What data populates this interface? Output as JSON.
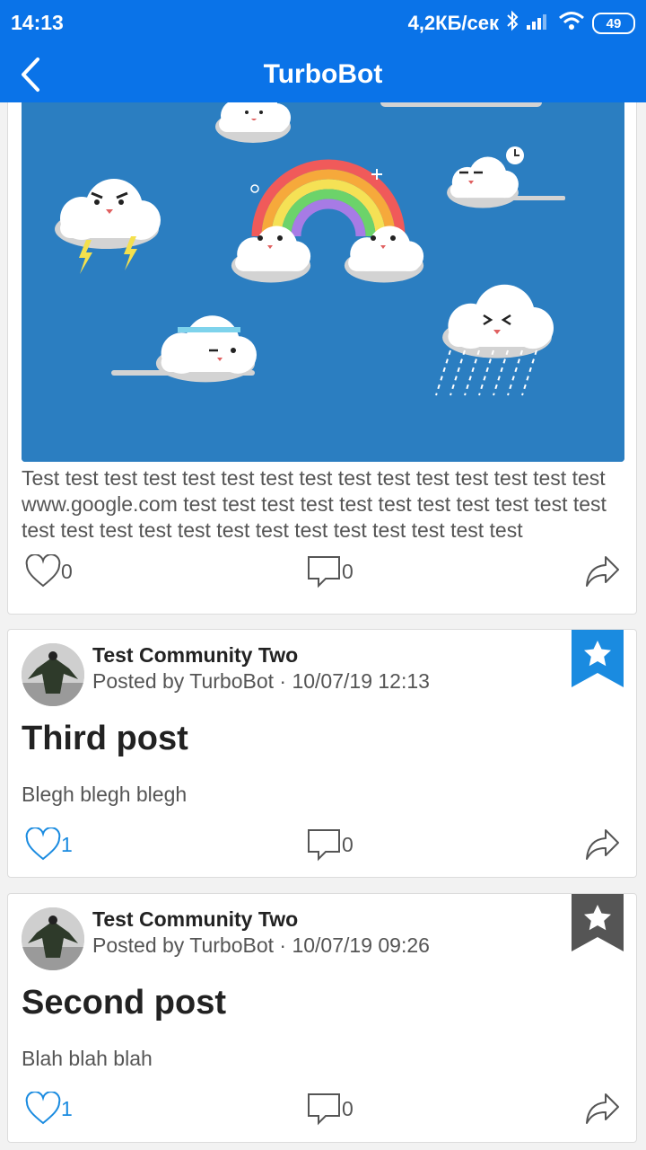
{
  "status_bar": {
    "time": "14:13",
    "network_speed": "4,2КБ/сек",
    "battery": "49",
    "icons": [
      "bluetooth-icon",
      "signal-icon",
      "wifi-icon",
      "battery-icon"
    ]
  },
  "app_bar": {
    "title": "TurboBot",
    "back_icon": "chevron-left-icon"
  },
  "colors": {
    "primary": "#0a73e8",
    "like_active": "#1a8be0",
    "bookmark_active": "#1a8be0",
    "bookmark_inactive": "#555555",
    "image_bg": "#2b7ec1"
  },
  "posts": [
    {
      "image_alt": "clouds-and-rainbow-illustration",
      "text": "Test test test test test test test test test test test test test test test www.google.com test test test test test test test test test test test test test test test test test test test test test test test test",
      "likes": "0",
      "liked": false,
      "comments": "0"
    },
    {
      "community": "Test Community Two",
      "meta": "Posted by TurboBot · 10/07/19 12:13",
      "title": "Third post",
      "body": "Blegh blegh blegh",
      "likes": "1",
      "liked": true,
      "comments": "0",
      "bookmarked": true
    },
    {
      "community": "Test Community Two",
      "meta": "Posted by TurboBot · 10/07/19 09:26",
      "title": "Second post",
      "body": "Blah blah blah",
      "likes": "1",
      "liked": true,
      "comments": "0",
      "bookmarked": false
    }
  ]
}
